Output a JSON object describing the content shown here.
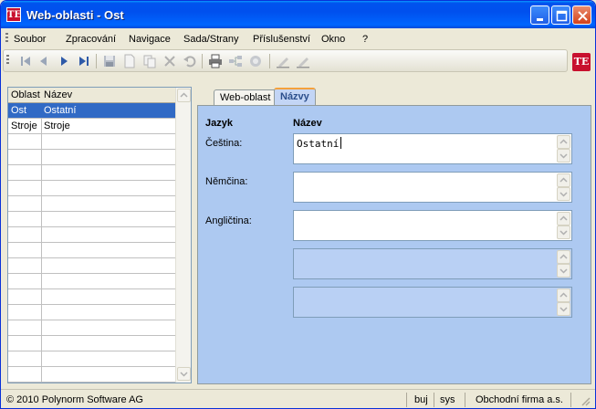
{
  "window": {
    "title": "Web-oblasti - Ost",
    "logo_text": "TE"
  },
  "menu": [
    "Soubor",
    "Zpracování",
    "Navigace",
    "Sada/Strany",
    "Příslušenství",
    "Okno",
    "?"
  ],
  "toolbar": {
    "icons": [
      "first-record-icon",
      "prev-record-icon",
      "next-record-icon",
      "last-record-icon",
      "save-icon",
      "new-icon",
      "copy-icon",
      "delete-icon",
      "undo-icon",
      "print-icon",
      "tree-icon",
      "stop-icon",
      "edit-icon",
      "edit-alt-icon"
    ],
    "right_logo": "TE"
  },
  "grid": {
    "headers": [
      "Oblast",
      "Název"
    ],
    "rows": [
      {
        "code": "Ost",
        "name": "Ostatní",
        "selected": true
      },
      {
        "code": "Stroje",
        "name": "Stroje",
        "selected": false
      }
    ]
  },
  "tabs": [
    {
      "label": "Web-oblast",
      "active": false
    },
    {
      "label": "Názvy",
      "active": true
    }
  ],
  "names_panel": {
    "col_language": "Jazyk",
    "col_name": "Název",
    "rows": [
      {
        "language": "Čeština:",
        "value": "Ostatní",
        "enabled": true
      },
      {
        "language": "Němčina:",
        "value": "",
        "enabled": true
      },
      {
        "language": "Angličtina:",
        "value": "",
        "enabled": true
      },
      {
        "language": "",
        "value": "",
        "enabled": false
      },
      {
        "language": "",
        "value": "",
        "enabled": false
      }
    ]
  },
  "status": {
    "copyright": "© 2010 Polynorm Software AG",
    "user": "buj",
    "system": "sys",
    "company": "Obchodní firma a.s."
  }
}
